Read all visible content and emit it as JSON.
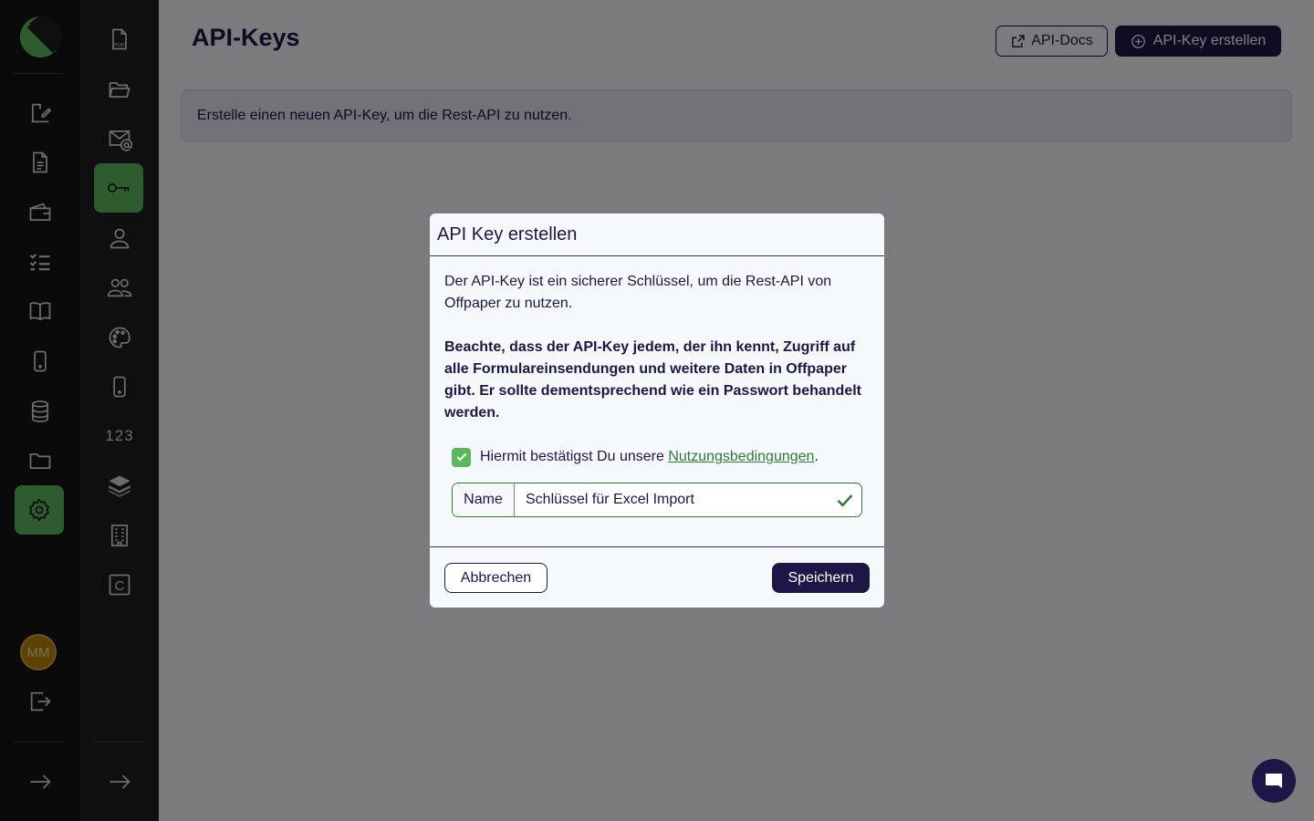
{
  "page": {
    "title": "API-Keys",
    "docs_button": "API-Docs",
    "create_button": "API-Key erstellen",
    "info_text": "Erstelle einen neuen API-Key, um die Rest-API zu nutzen."
  },
  "sidebar": {
    "avatar_initials": "MM",
    "numbers_label": "123",
    "c_label": "C",
    "primary_items": [
      "edit-icon",
      "document-icon",
      "wallet-icon",
      "checklist-icon",
      "book-icon",
      "phone-icon",
      "database-icon",
      "folder-icon",
      "settings-icon"
    ],
    "secondary_items": [
      "pdf-icon",
      "folder-open-icon",
      "mail-at-icon",
      "key-icon",
      "person-icon",
      "people-icon",
      "palette-icon",
      "phone-icon",
      "numbers-icon",
      "layers-icon",
      "building-icon",
      "c-square-icon"
    ],
    "active_primary": "settings-icon",
    "active_secondary": "key-icon"
  },
  "modal": {
    "title": "API Key erstellen",
    "description": "Der API-Key ist ein sicherer Schlüssel, um die Rest-API von Offpaper zu nutzen.",
    "warning": "Beachte, dass der API-Key jedem, der ihn kennt, Zugriff auf alle Formulareinsendungen und weitere Daten in Offpaper gibt. Er sollte dementsprechend wie ein Passwort behandelt werden.",
    "consent_prefix": "Hiermit bestätigst Du unsere ",
    "consent_link": "Nutzungsbedingungen",
    "consent_suffix": ".",
    "consent_checked": true,
    "name_label": "Name",
    "name_value": "Schlüssel für Excel Import",
    "cancel_label": "Abbrechen",
    "save_label": "Speichern"
  },
  "colors": {
    "accent_green": "#5cb85c",
    "brand_dark": "#201547"
  }
}
